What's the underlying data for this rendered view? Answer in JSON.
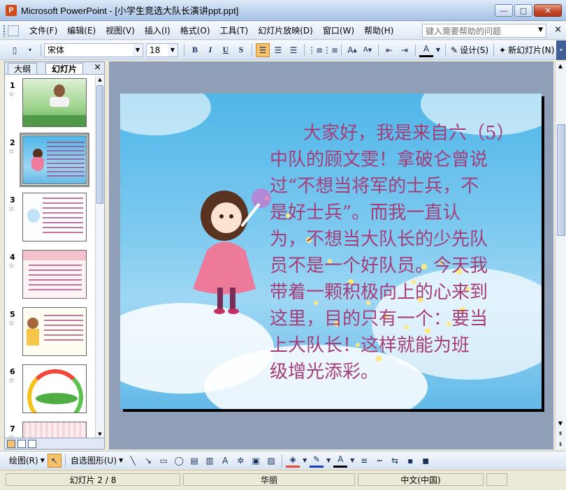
{
  "window": {
    "app_name": "Microsoft PowerPoint",
    "title": "Microsoft PowerPoint - [小学生竞选大队长演讲ppt.ppt]",
    "minimize": "—",
    "maximize": "□",
    "close": "✕"
  },
  "menu": {
    "items": [
      "文件(F)",
      "编辑(E)",
      "视图(V)",
      "插入(I)",
      "格式(O)",
      "工具(T)",
      "幻灯片放映(D)",
      "窗口(W)",
      "帮助(H)"
    ],
    "help_placeholder": "键入需要帮助的问题",
    "close_doc": "×"
  },
  "format_toolbar": {
    "font": "宋体",
    "size": "18",
    "bold": "B",
    "italic": "I",
    "underline": "U",
    "shadow": "S",
    "design_label": "设计(S)",
    "new_slide_label": "新幻灯片(N)"
  },
  "side_panel": {
    "tabs": [
      "大纲",
      "幻灯片"
    ],
    "close": "×",
    "thumbnails": [
      {
        "number": "1",
        "star": "☆",
        "theme": "green-field"
      },
      {
        "number": "2",
        "star": "☆",
        "theme": "sky-girl",
        "selected": true
      },
      {
        "number": "3",
        "star": "☆",
        "theme": "white-kid"
      },
      {
        "number": "4",
        "star": "☆",
        "theme": "pink-border"
      },
      {
        "number": "5",
        "star": "☆",
        "theme": "yellow-boy"
      },
      {
        "number": "6",
        "star": "☆",
        "theme": "rainbow"
      },
      {
        "number": "7",
        "star": "☆",
        "theme": "pink-stripes"
      }
    ]
  },
  "slide": {
    "lines": [
      "大家好，我是来自六（5）",
      "中队的顾文雯！拿破仑曾说",
      "过“不想当将军的士兵，不",
      "是好士兵”。而我一直认",
      "为，不想当大队长的少先队",
      "员不是一个好队员。今天我",
      "带着一颗积极向上的心来到",
      "这里，目的只有一个：要当",
      "上大队长！这样就能为班",
      "级增光添彩。"
    ]
  },
  "draw_toolbar": {
    "draw_label": "绘图(R)",
    "autoshapes_label": "自选图形(U)"
  },
  "status": {
    "slide_info": "幻灯片 2 / 8",
    "design": "华丽",
    "language": "中文(中国)"
  }
}
